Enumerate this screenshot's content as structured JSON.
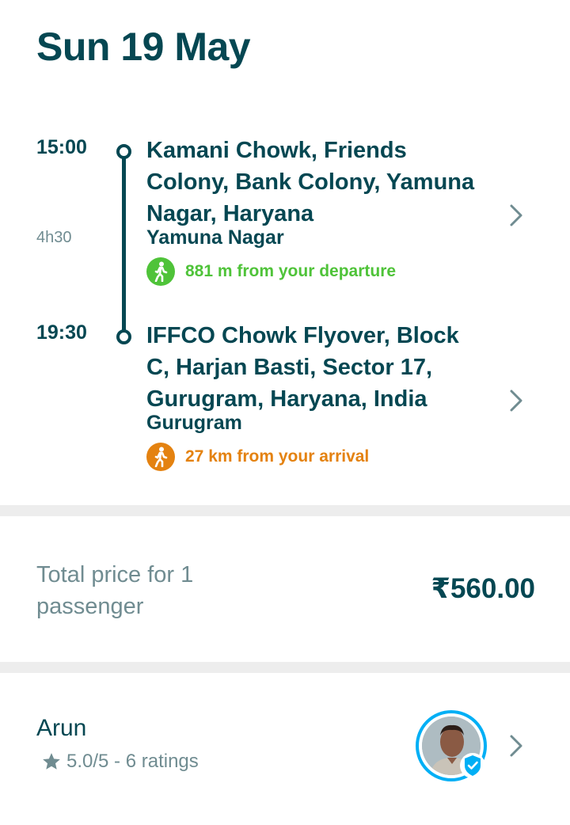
{
  "header": {
    "date": "Sun 19 May"
  },
  "trip": {
    "departure": {
      "time": "15:00",
      "address": "Kamani Chowk, Friends Colony, Bank Colony, Yamuna Nagar, Haryana",
      "city": "Yamuna Nagar",
      "walk_text": "881 m from your departure",
      "walk_color": "#4fc339",
      "icon": "walking-person-icon"
    },
    "duration": "4h30",
    "arrival": {
      "time": "19:30",
      "address": "IFFCO Chowk Flyover, Block C, Harjan Basti, Sector 17, Gurugram, Haryana, India",
      "city": "Gurugram",
      "walk_text": "27 km from your arrival",
      "walk_color": "#e48210",
      "icon": "walking-person-icon"
    }
  },
  "price": {
    "label": "Total price for 1 passenger",
    "value": "₹560.00"
  },
  "driver": {
    "name": "Arun",
    "rating": "5.0/5 - 6 ratings",
    "verified": true
  },
  "colors": {
    "primary": "#054752",
    "secondary": "#708c91",
    "accent": "#00aff5",
    "separator": "#ededed"
  }
}
